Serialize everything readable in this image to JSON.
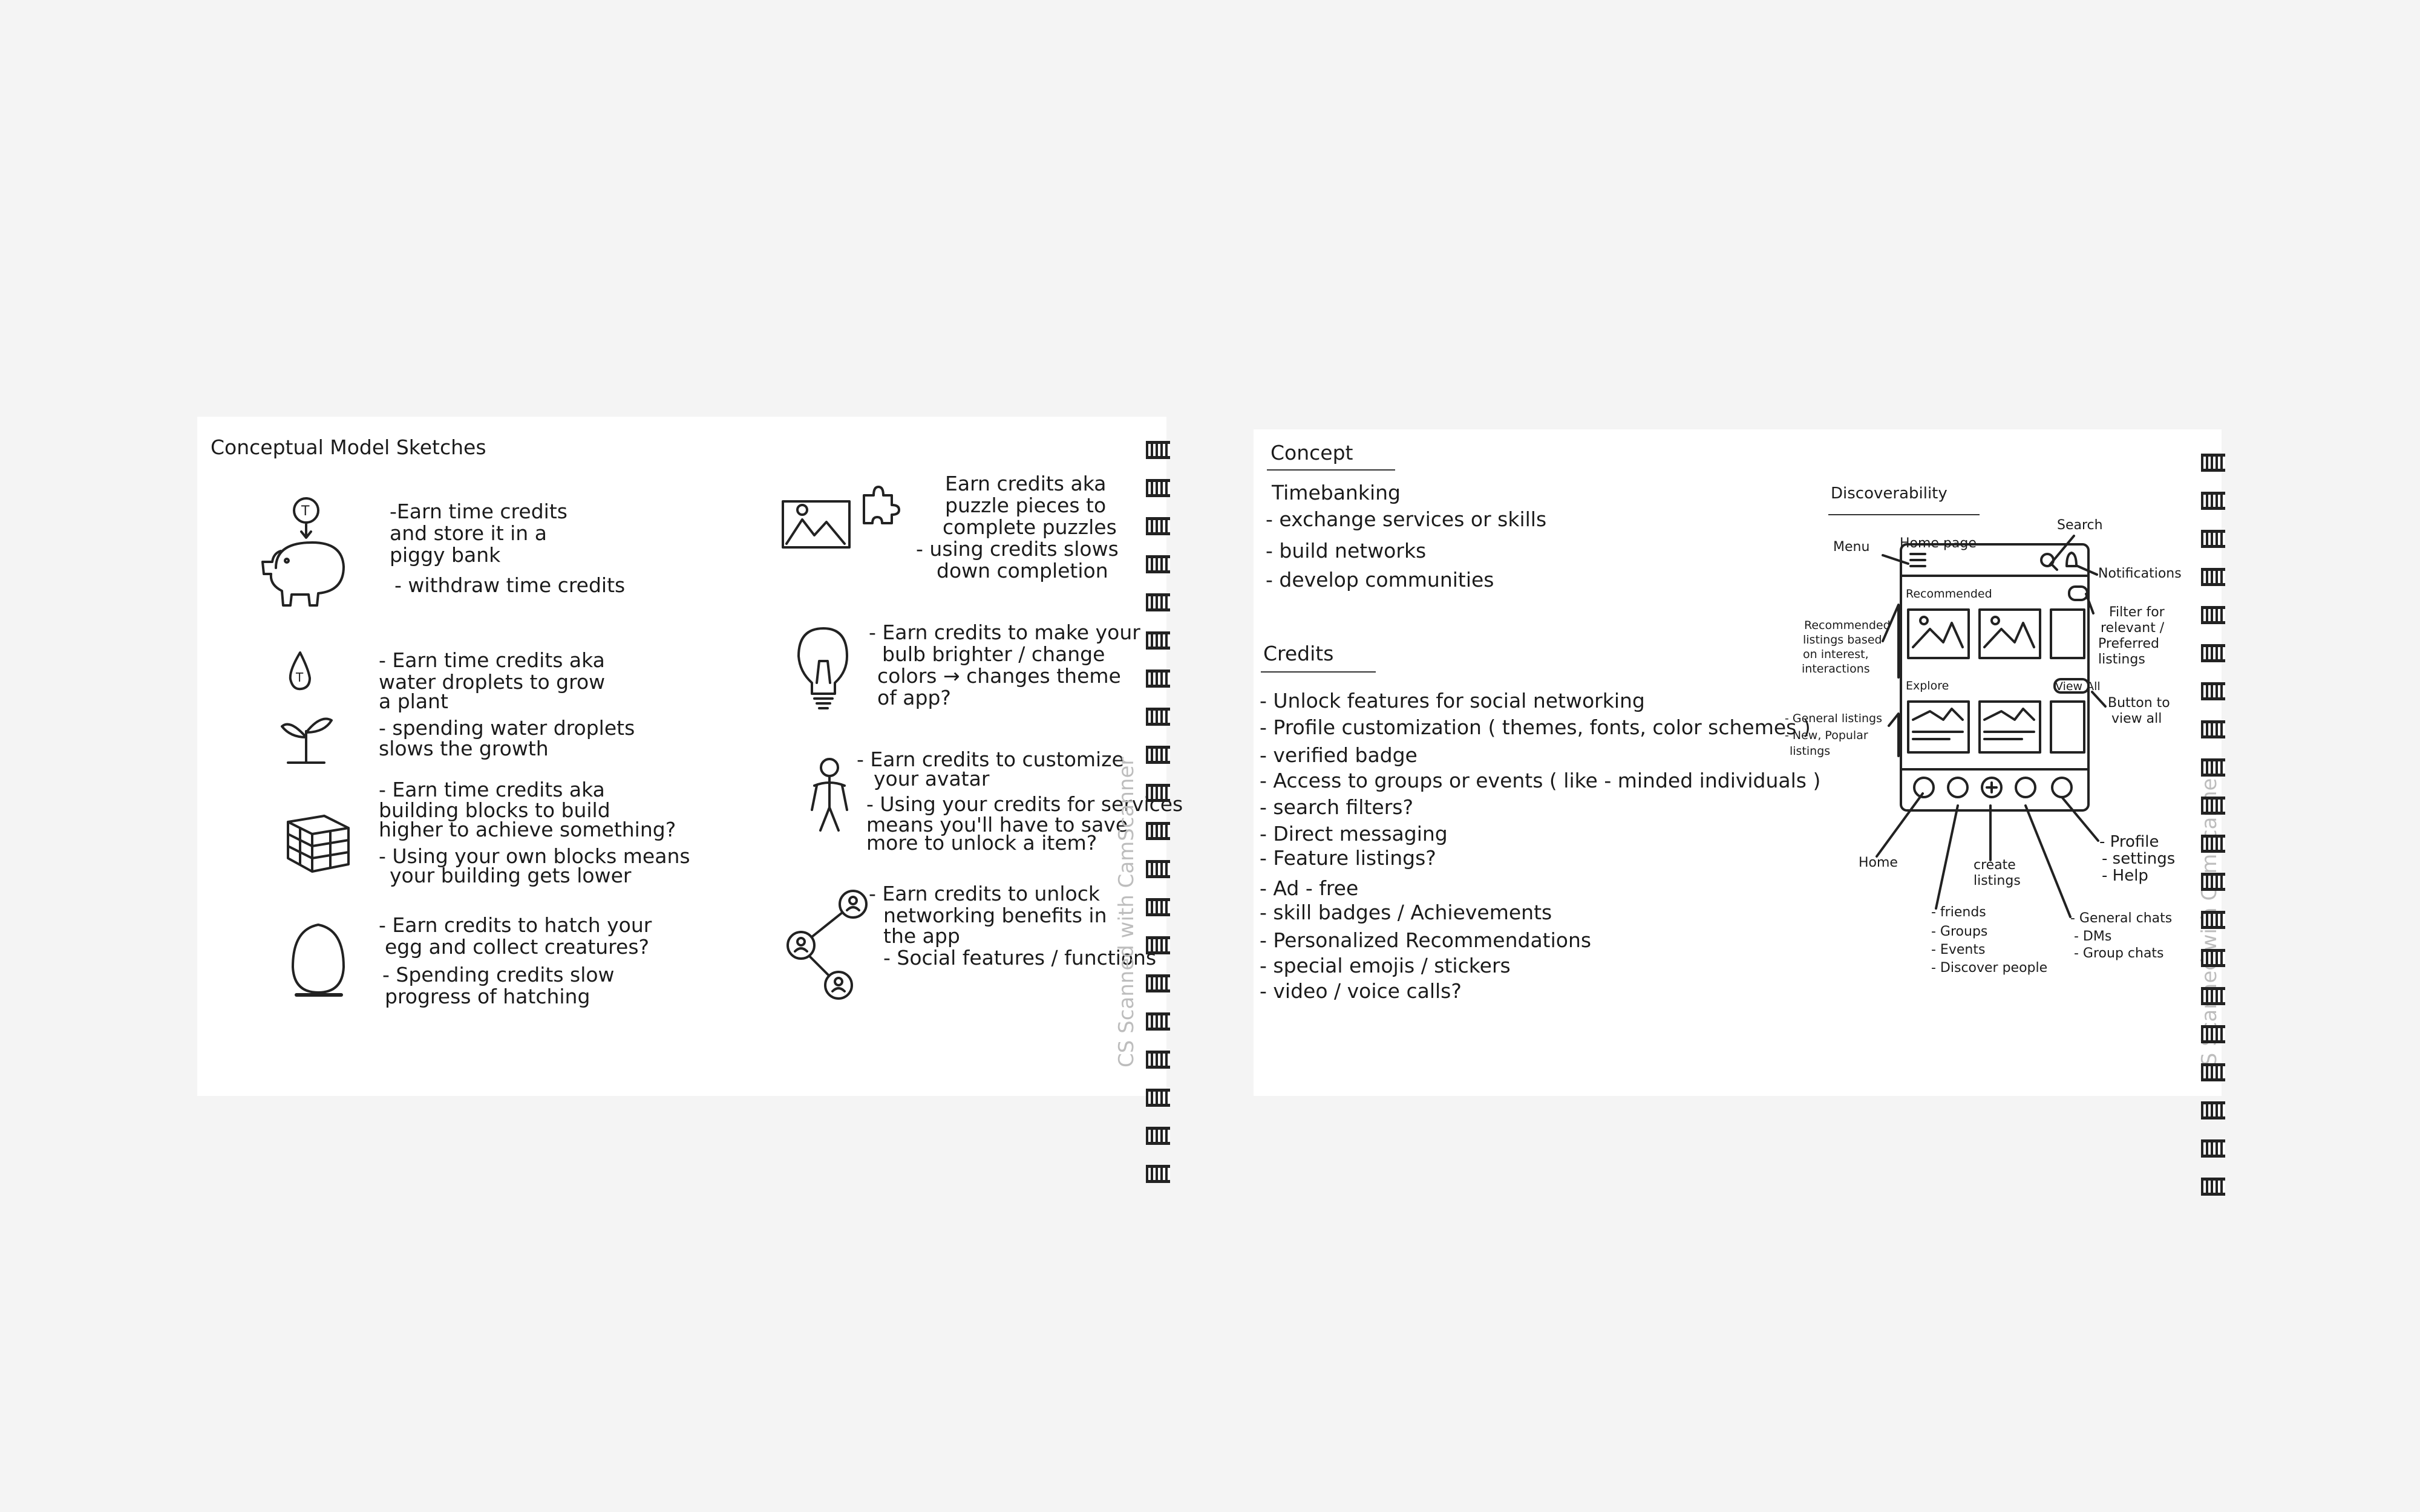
{
  "left_page": {
    "title": "Conceptual Model Sketches",
    "piggy": {
      "icon_label": "T",
      "lines": [
        "-Earn time credits",
        "and store it in a",
        "piggy bank",
        "- withdraw time credits"
      ]
    },
    "droplet": {
      "icon_label": "T",
      "lines": [
        "- Earn time credits aka",
        "water droplets to grow",
        "a plant",
        "- spending water droplets",
        "slows the growth"
      ]
    },
    "blocks": {
      "lines": [
        "- Earn time credits aka",
        "building blocks to build",
        "higher to achieve something?",
        "- Using your own blocks means",
        "your building gets lower"
      ]
    },
    "egg": {
      "lines": [
        "- Earn credits to hatch your",
        "egg and collect creatures?",
        "- Spending credits slow",
        "progress of hatching"
      ]
    },
    "puzzle": {
      "lines": [
        "Earn credits aka",
        "puzzle pieces to",
        "complete puzzles",
        "- using credits slows",
        "down completion"
      ]
    },
    "bulb": {
      "lines": [
        "- Earn credits to make your",
        "bulb brighter / change",
        "colors → changes theme",
        "of app?"
      ]
    },
    "avatar": {
      "lines": [
        "- Earn credits to customize",
        "your avatar",
        "- Using your credits for services",
        "means you'll have to save",
        "more to unlock a item?"
      ]
    },
    "network": {
      "lines": [
        "- Earn credits to unlock",
        "networking benefits in",
        "the app",
        "- Social features / functions"
      ]
    },
    "watermark": "CS Scanned with CamScanner"
  },
  "right_page": {
    "title": "Concept",
    "timebanking": {
      "heading": "Timebanking",
      "items": [
        "- exchange services or skills",
        "- build networks",
        "- develop communities"
      ]
    },
    "credits": {
      "heading": "Credits",
      "items": [
        "- Unlock features for social networking",
        "- Profile customization ( themes, fonts, color schemes )",
        "- verified badge",
        "- Access to groups or events ( like - minded individuals )",
        "- search filters?",
        "- Direct messaging",
        "- Feature listings?",
        "- Ad - free",
        "- skill badges / Achievements",
        "- Personalized Recommendations",
        "- special emojis / stickers",
        "- video / voice calls?"
      ]
    },
    "discoverability": {
      "heading": "Discoverability",
      "menu": "Menu",
      "home_page": "Home page",
      "search": "Search",
      "notifications": "Notifications",
      "recommended": "Recommended",
      "explore": "Explore",
      "view_all_button": "View All",
      "filter_note": [
        "Filter for",
        "relevant /",
        "Preferred",
        "listings"
      ],
      "view_all_note": [
        "Button to",
        "view all"
      ],
      "recommended_note": [
        "Recommended",
        "listings based",
        "on interest,",
        "interactions"
      ],
      "general_listings_note": [
        "- General listings",
        "- New, Popular",
        "listings"
      ],
      "home": "Home",
      "create_listings": [
        "create",
        "listings"
      ],
      "profile_note": [
        "- Profile",
        "- settings",
        "- Help"
      ],
      "community_note": [
        "- friends",
        "- Groups",
        "- Events",
        "- Discover people"
      ],
      "chats_note": [
        "- General chats",
        "- DMs",
        "- Group chats"
      ]
    },
    "watermark": "CS Scanned with CamScanner"
  }
}
